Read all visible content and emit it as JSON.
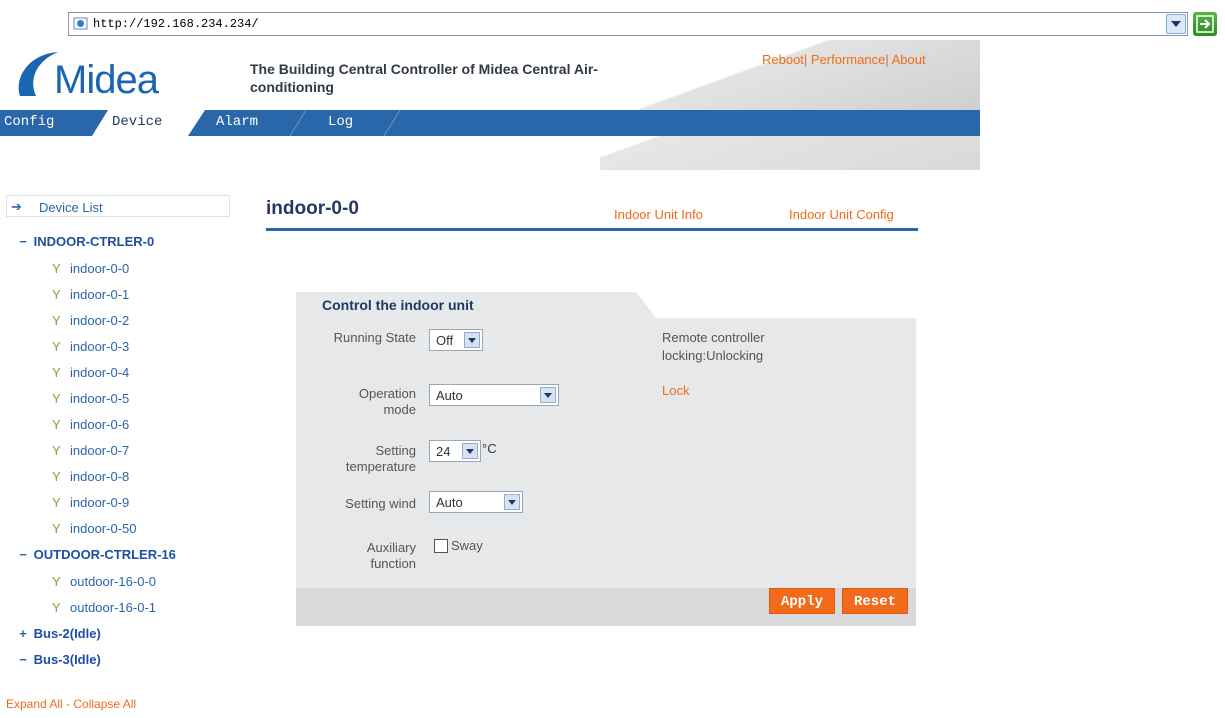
{
  "browser": {
    "url": "http://192.168.234.234/"
  },
  "header": {
    "logo": "Midea",
    "title": "The Building Central Controller of Midea Central Air-conditioning",
    "title_line1": "The Building Central Controller of Midea Central Air-",
    "title_line2": "conditioning",
    "links": {
      "reboot": "Reboot|",
      "performance": " Performance|",
      "about": " About"
    }
  },
  "nav": {
    "tabs": [
      "Config",
      "Device",
      "Alarm",
      "Log"
    ],
    "active": "Device"
  },
  "sidebar": {
    "device_list": "Device List",
    "groups": [
      {
        "sign": "−",
        "label": "INDOOR-CTRLER-0"
      },
      {
        "sign": "−",
        "label": "OUTDOOR-CTRLER-16"
      },
      {
        "sign": "+",
        "label": "Bus-2(Idle)"
      },
      {
        "sign": "−",
        "label": "Bus-3(Idle)"
      }
    ],
    "indoor_items": [
      "indoor-0-0",
      "indoor-0-1",
      "indoor-0-2",
      "indoor-0-3",
      "indoor-0-4",
      "indoor-0-5",
      "indoor-0-6",
      "indoor-0-7",
      "indoor-0-8",
      "indoor-0-9",
      "indoor-0-50"
    ],
    "outdoor_items": [
      "outdoor-16-0-0",
      "outdoor-16-0-1"
    ],
    "expand_collapse": "Expand All - Collapse All"
  },
  "main": {
    "unit_title": "indoor-0-0",
    "info_link": "Indoor Unit Info",
    "config_link": "Indoor Unit Config",
    "control_title": "Control the indoor unit",
    "running_state_label": "Running State",
    "running_state_value": "Off",
    "operation_mode_label": "Operation mode",
    "operation_mode_line1": "Operation",
    "operation_mode_line2": "mode",
    "operation_mode_value": "Auto",
    "setting_temp_line1": "Setting",
    "setting_temp_line2": "temperature",
    "setting_temp_value": "24",
    "temp_unit": "°C",
    "setting_wind_label": "Setting wind",
    "setting_wind_value": "Auto",
    "aux_line1": "Auxiliary",
    "aux_line2": "function",
    "sway_label": "Sway",
    "lock_state_line1": "Remote controller",
    "lock_state_line2": "locking:Unlocking",
    "lock_link": "Lock",
    "apply": "Apply",
    "reset": "Reset"
  },
  "colors": {
    "accent_orange": "#f06a1a",
    "nav_blue": "#2a66aa",
    "logo_blue": "#1a66b2"
  }
}
